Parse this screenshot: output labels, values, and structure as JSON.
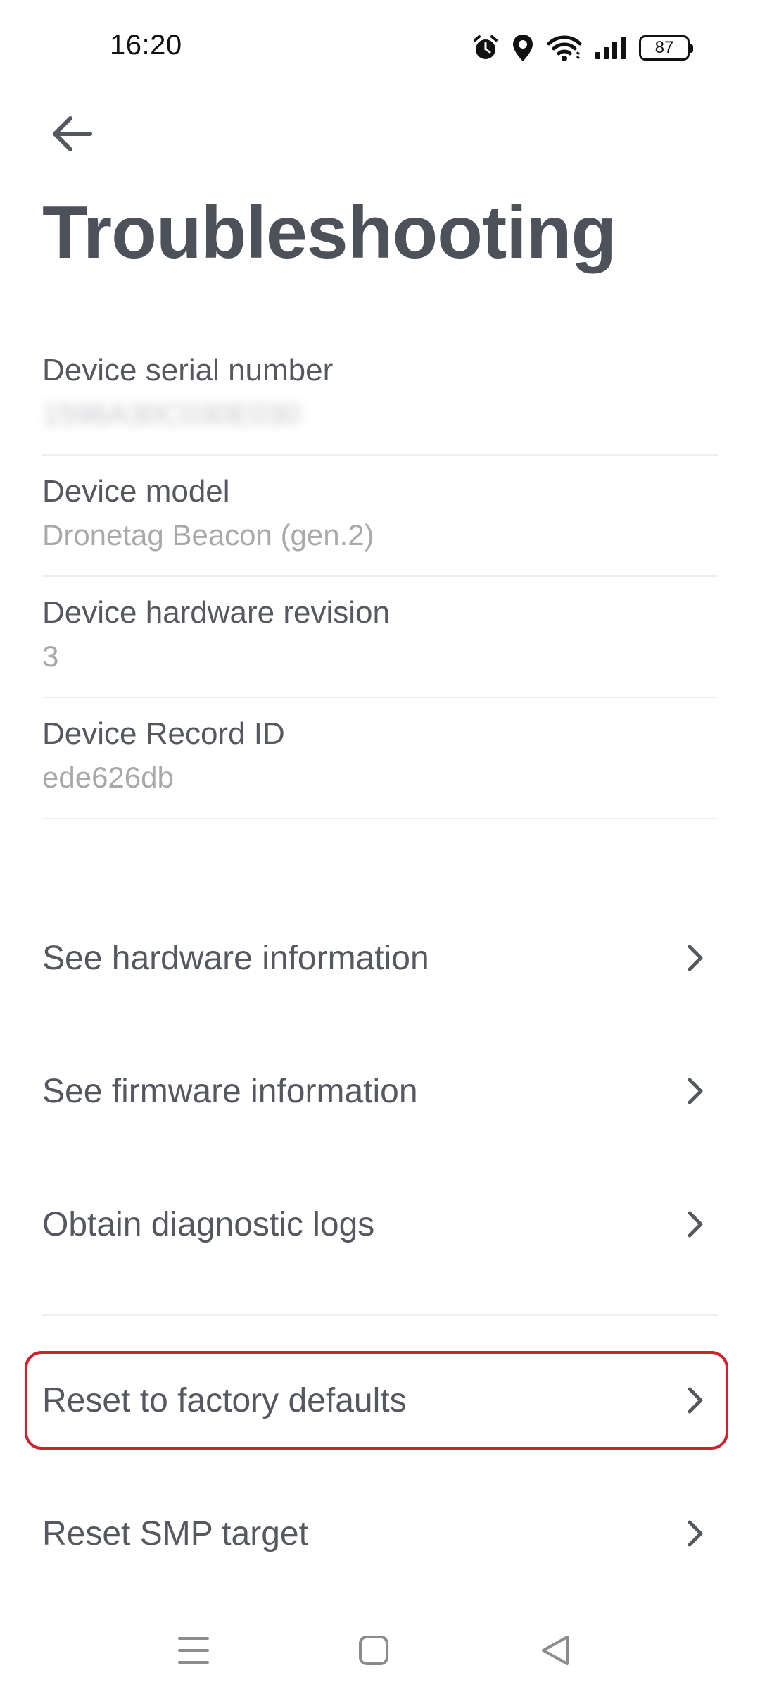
{
  "status_bar": {
    "time": "16:20",
    "icons": [
      "alarm-icon",
      "location-icon",
      "wifi-icon",
      "signal-icon"
    ],
    "battery": "87"
  },
  "header": {
    "back_icon": "arrow-left-icon",
    "title": "Troubleshooting"
  },
  "info": [
    {
      "label": "Device serial number",
      "value": "1596A30C030E030"
    },
    {
      "label": "Device model",
      "value": "Dronetag Beacon (gen.2)"
    },
    {
      "label": "Device hardware revision",
      "value": "3"
    },
    {
      "label": "Device Record ID",
      "value": "ede626db"
    }
  ],
  "actions": [
    {
      "label": "See hardware information",
      "icon": "chevron-right-icon"
    },
    {
      "label": "See firmware information",
      "icon": "chevron-right-icon"
    },
    {
      "label": "Obtain diagnostic logs",
      "icon": "chevron-right-icon"
    },
    {
      "label": "Reset to factory defaults",
      "icon": "chevron-right-icon",
      "highlighted": true
    },
    {
      "label": "Reset SMP target",
      "icon": "chevron-right-icon"
    }
  ],
  "nav_bar": {
    "icons": [
      "menu-icon",
      "home-icon",
      "back-triangle-icon"
    ]
  },
  "colors": {
    "highlight": "#d4202c",
    "title": "#4d525a",
    "secondary_text": "#a7a9ad"
  }
}
